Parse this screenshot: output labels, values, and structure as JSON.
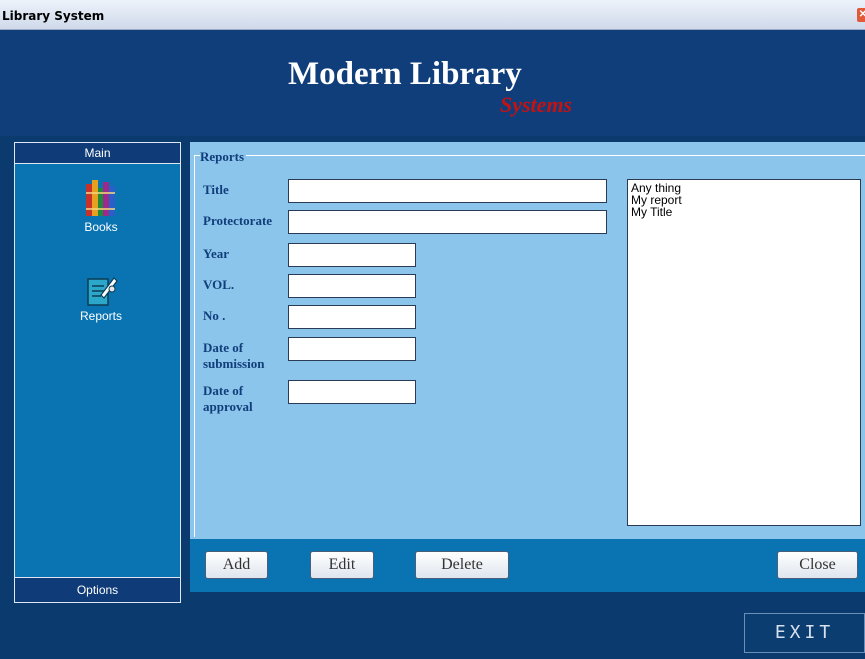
{
  "window": {
    "title": "Library System",
    "close_icon": "close-icon"
  },
  "banner": {
    "line1": "Modern Library",
    "line2": "Systems"
  },
  "sidebar": {
    "header": "Main",
    "items": [
      {
        "label": "Books",
        "icon": "books-icon"
      },
      {
        "label": "Reports",
        "icon": "reports-icon"
      }
    ],
    "footer": "Options"
  },
  "reports": {
    "legend": "Reports",
    "fields": [
      {
        "label": "Title",
        "value": ""
      },
      {
        "label": "Protectorate",
        "value": ""
      },
      {
        "label": "Year",
        "value": ""
      },
      {
        "label": "VOL.",
        "value": ""
      },
      {
        "label": "No .",
        "value": ""
      },
      {
        "label_line1": "Date of",
        "label_line2": "submission",
        "value": ""
      },
      {
        "label_line1": "Date of",
        "label_line2": "approval",
        "value": ""
      }
    ],
    "list": [
      "Any thing",
      "My report",
      "My Title"
    ],
    "buttons": {
      "add": "Add",
      "edit": "Edit",
      "delete": "Delete",
      "close": "Close"
    }
  },
  "exit_label": "EXIT",
  "colors": {
    "banner": "#103e7a",
    "accent_red": "#c11313",
    "panel": "#8cc5ec",
    "sidebar": "#0a74b2"
  }
}
